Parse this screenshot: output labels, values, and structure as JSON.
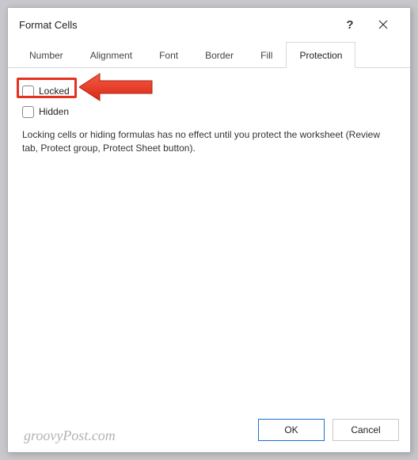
{
  "titlebar": {
    "title": "Format Cells",
    "help": "?"
  },
  "tabs": [
    {
      "label": "Number",
      "active": false
    },
    {
      "label": "Alignment",
      "active": false
    },
    {
      "label": "Font",
      "active": false
    },
    {
      "label": "Border",
      "active": false
    },
    {
      "label": "Fill",
      "active": false
    },
    {
      "label": "Protection",
      "active": true
    }
  ],
  "panel": {
    "locked_label": "Locked",
    "hidden_label": "Hidden",
    "body_text": "Locking cells or hiding formulas has no effect until you protect the worksheet (Review tab, Protect group, Protect Sheet button)."
  },
  "footer": {
    "ok": "OK",
    "cancel": "Cancel"
  },
  "watermark": "groovyPost.com"
}
